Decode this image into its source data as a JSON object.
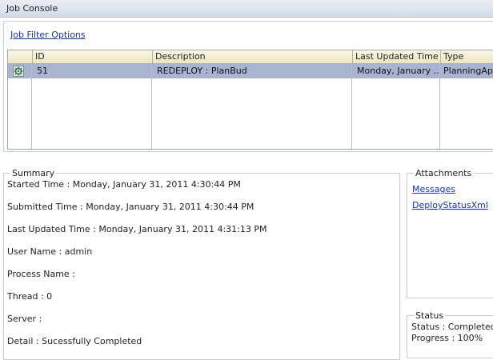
{
  "window": {
    "title": "Job Console"
  },
  "filter": {
    "link_label": "Job Filter Options"
  },
  "grid": {
    "columns": [
      "ID",
      "Description",
      "Last Updated Time",
      "Type"
    ],
    "rows": [
      {
        "id": "51",
        "description": "REDEPLOY : PlanBud",
        "last_updated": "Monday, January ...",
        "type": "PlanningAppl",
        "icon": "gear-refresh-icon"
      }
    ]
  },
  "summary": {
    "legend": "Summary",
    "lines": [
      "Started Time : Monday, January 31, 2011 4:30:44 PM",
      "Submitted Time : Monday, January 31, 2011 4:30:44 PM",
      "Last Updated Time : Monday, January 31, 2011 4:31:13 PM",
      "User Name : admin",
      "Process Name :",
      "Thread : 0",
      "Server :",
      "Detail : Sucessfully Completed"
    ]
  },
  "attachments": {
    "legend": "Attachments",
    "links": [
      "Messages",
      "DeployStatusXml"
    ]
  },
  "status": {
    "legend": "Status",
    "status_text": "Status : Completed",
    "progress_text": "Progress : 100%",
    "progress": 1.0
  },
  "colors": {
    "selected_row": "#a8b4d2",
    "link": "#1a34a8",
    "header_bg": "#ece5c4"
  }
}
